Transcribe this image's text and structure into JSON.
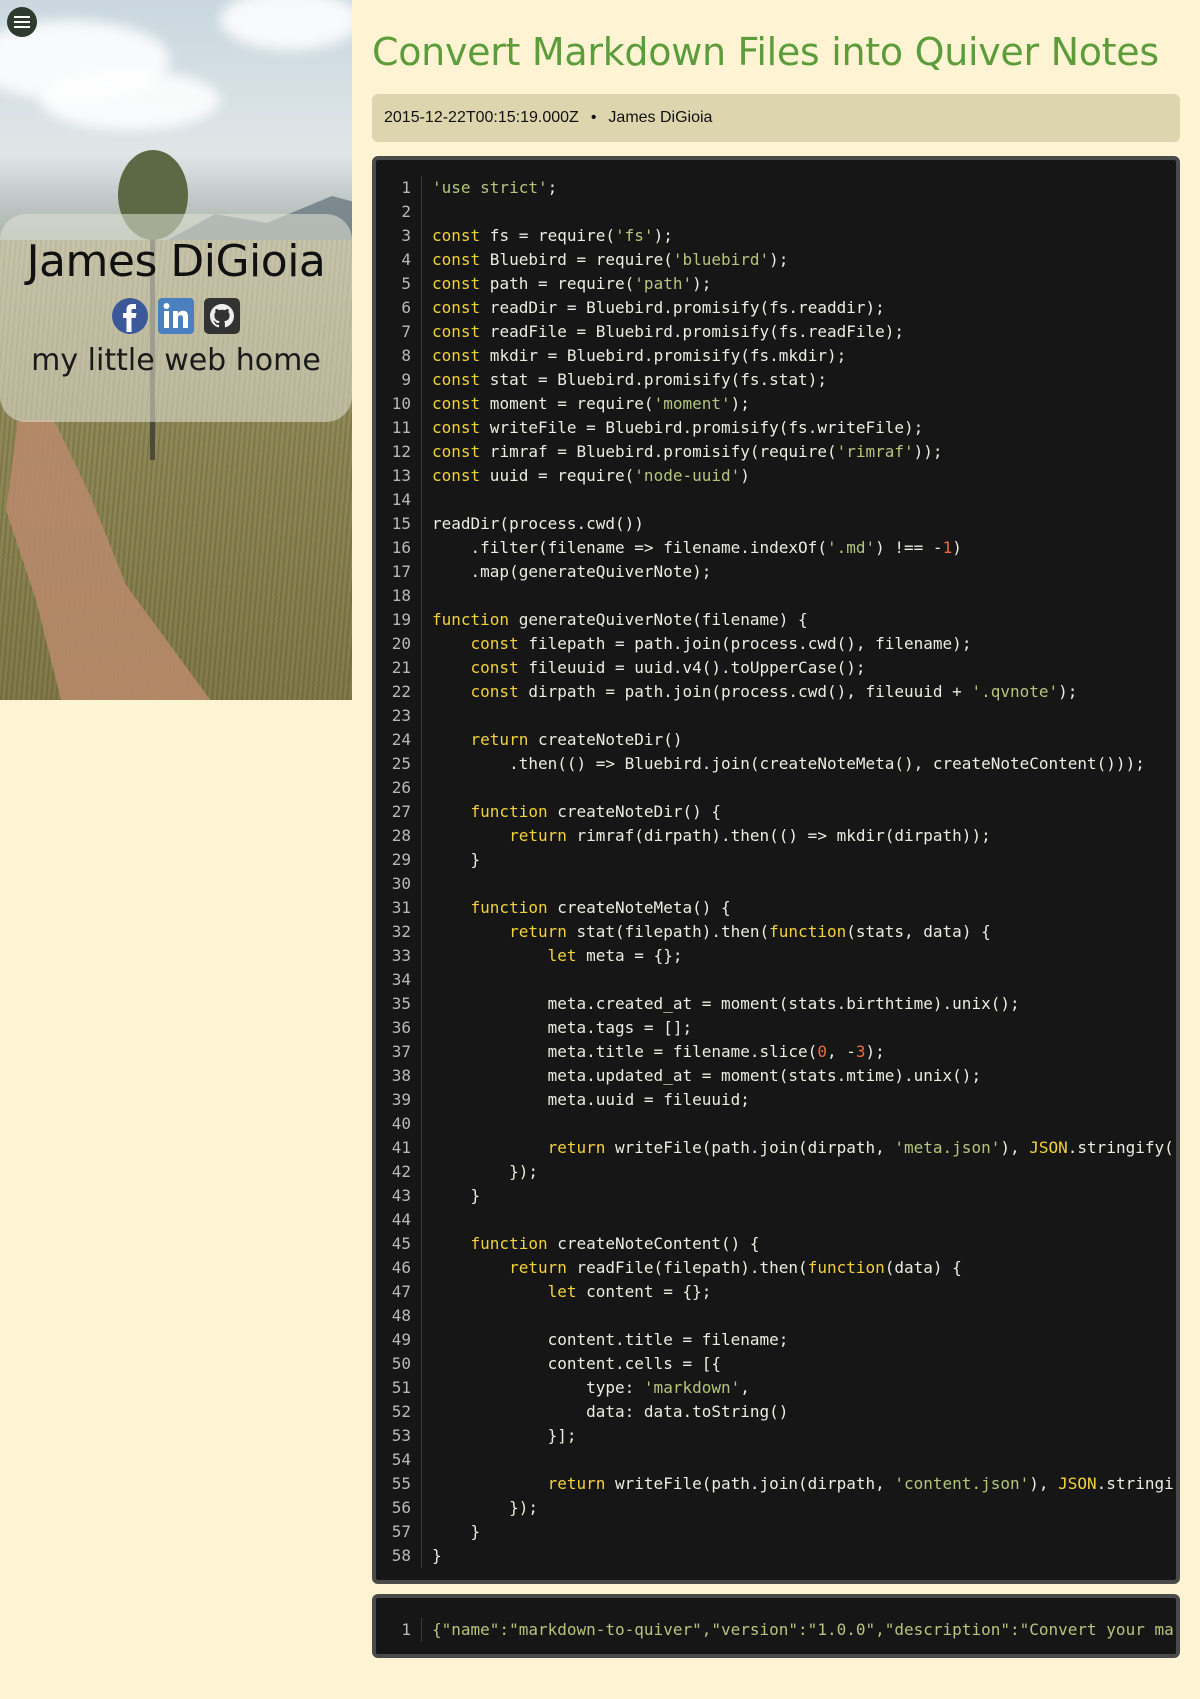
{
  "sidebar": {
    "name": "James DiGioia",
    "tagline": "my little web home",
    "social": [
      "facebook-icon",
      "linkedin-icon",
      "github-icon"
    ]
  },
  "post": {
    "title": "Convert Markdown Files into Quiver Notes",
    "date": "2015-12-22T00:15:19.000Z",
    "separator": "•",
    "author": "James DiGioia"
  },
  "code": {
    "lines": [
      "'use strict';",
      "",
      "const fs = require('fs');",
      "const Bluebird = require('bluebird');",
      "const path = require('path');",
      "const readDir = Bluebird.promisify(fs.readdir);",
      "const readFile = Bluebird.promisify(fs.readFile);",
      "const mkdir = Bluebird.promisify(fs.mkdir);",
      "const stat = Bluebird.promisify(fs.stat);",
      "const moment = require('moment');",
      "const writeFile = Bluebird.promisify(fs.writeFile);",
      "const rimraf = Bluebird.promisify(require('rimraf'));",
      "const uuid = require('node-uuid')",
      "",
      "readDir(process.cwd())",
      "    .filter(filename => filename.indexOf('.md') !== -1)",
      "    .map(generateQuiverNote);",
      "",
      "function generateQuiverNote(filename) {",
      "    const filepath = path.join(process.cwd(), filename);",
      "    const fileuuid = uuid.v4().toUpperCase();",
      "    const dirpath = path.join(process.cwd(), fileuuid + '.qvnote');",
      "",
      "    return createNoteDir()",
      "        .then(() => Bluebird.join(createNoteMeta(), createNoteContent()));",
      "",
      "    function createNoteDir() {",
      "        return rimraf(dirpath).then(() => mkdir(dirpath));",
      "    }",
      "",
      "    function createNoteMeta() {",
      "        return stat(filepath).then(function(stats, data) {",
      "            let meta = {};",
      "",
      "            meta.created_at = moment(stats.birthtime).unix();",
      "            meta.tags = [];",
      "            meta.title = filename.slice(0, -3);",
      "            meta.updated_at = moment(stats.mtime).unix();",
      "            meta.uuid = fileuuid;",
      "",
      "            return writeFile(path.join(dirpath, 'meta.json'), JSON.stringify(",
      "        });",
      "    }",
      "",
      "    function createNoteContent() {",
      "        return readFile(filepath).then(function(data) {",
      "            let content = {};",
      "",
      "            content.title = filename;",
      "            content.cells = [{",
      "                type: 'markdown',",
      "                data: data.toString()",
      "            }];",
      "",
      "            return writeFile(path.join(dirpath, 'content.json'), JSON.stringi",
      "        });",
      "    }",
      "}"
    ],
    "second_block": "{\"name\":\"markdown-to-quiver\",\"version\":\"1.0.0\",\"description\":\"Convert your ma"
  }
}
